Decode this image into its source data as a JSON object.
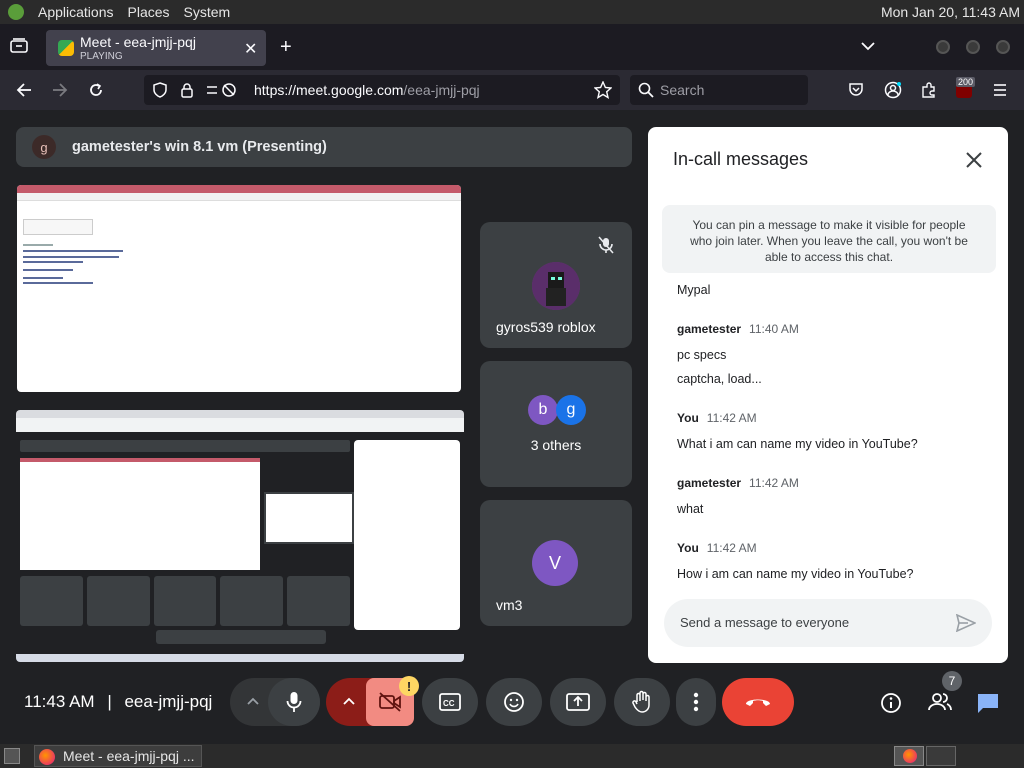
{
  "os": {
    "menu": [
      "Applications",
      "Places",
      "System"
    ],
    "clock": "Mon Jan 20, 11:43 AM"
  },
  "browser": {
    "tab_title": "Meet - eea-jmjj-pqj",
    "tab_status": "PLAYING",
    "url_prefix": "https://meet.google.com",
    "url_path": "/eea-jmjj-pqj",
    "search_placeholder": "Search",
    "extension_badge": "200"
  },
  "presentation": {
    "title": "gametester's win 8.1 vm (Presenting)",
    "avatar_letter": "g"
  },
  "participants": [
    {
      "name": "gyros539 roblox",
      "muted": true
    },
    {
      "name": "3 others",
      "letters": [
        "b",
        "g"
      ]
    },
    {
      "name": "vm3",
      "letter": "V"
    }
  ],
  "chat": {
    "title": "In-call messages",
    "pin_notice": "You can pin a message to make it visible for people who join later. When you leave the call, you won't be able to access this chat.",
    "partial_text": "Mypal",
    "messages": [
      {
        "sender": "gametester",
        "time": "11:40 AM",
        "lines": [
          "pc specs",
          "captcha, load..."
        ]
      },
      {
        "sender": "You",
        "time": "11:42 AM",
        "lines": [
          "What i am can name my video in YouTube?"
        ]
      },
      {
        "sender": "gametester",
        "time": "11:42 AM",
        "lines": [
          "what"
        ]
      },
      {
        "sender": "You",
        "time": "11:42 AM",
        "lines": [
          "How i am can name my video in YouTube?"
        ]
      }
    ],
    "input_placeholder": "Send a message to everyone"
  },
  "bottom": {
    "time": "11:43 AM",
    "separator": "|",
    "meeting_code": "eea-jmjj-pqj",
    "people_count": "7",
    "warning_badge": "!"
  },
  "taskbar": {
    "window_title": "Meet - eea-jmjj-pqj ..."
  },
  "colors": {
    "end_call": "#ea4335",
    "camera_off": "#f28b82",
    "camera_off_dark": "#8c1d18",
    "avatar_purple": "#7e57c2",
    "avatar_blue": "#1a73e8",
    "chat_active": "#8ab4f8",
    "warning": "#fdd663"
  }
}
